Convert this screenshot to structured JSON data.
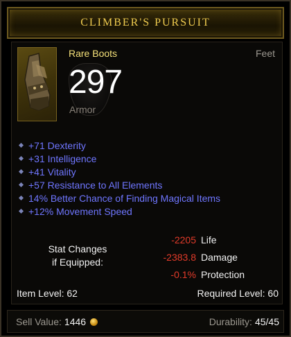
{
  "item": {
    "name": "CLIMBER'S PURSUIT",
    "type": "Rare Boots",
    "slot": "Feet",
    "armor_value": "297",
    "armor_label": "Armor",
    "icon": "boots-icon"
  },
  "affixes": [
    "+71 Dexterity",
    "+31 Intelligence",
    "+41 Vitality",
    "+57 Resistance to All Elements",
    "14% Better Chance of Finding Magical Items",
    "+12% Movement Speed"
  ],
  "stat_changes": {
    "label_line1": "Stat Changes",
    "label_line2": "if Equipped:",
    "rows": [
      {
        "value": "-2205",
        "name": "Life"
      },
      {
        "value": "-2383.8",
        "name": "Damage"
      },
      {
        "value": "-0.1%",
        "name": "Protection"
      }
    ]
  },
  "levels": {
    "item_level": "Item Level: 62",
    "required_level": "Required Level: 60"
  },
  "footer": {
    "sell_label": "Sell Value:",
    "sell_value": "1446",
    "durability_label": "Durability:",
    "durability_value": "45/45"
  },
  "colors": {
    "title": "#f0cc4f",
    "rare": "#f6e27a",
    "affix": "#6f76ff",
    "negative": "#e33b2a"
  }
}
